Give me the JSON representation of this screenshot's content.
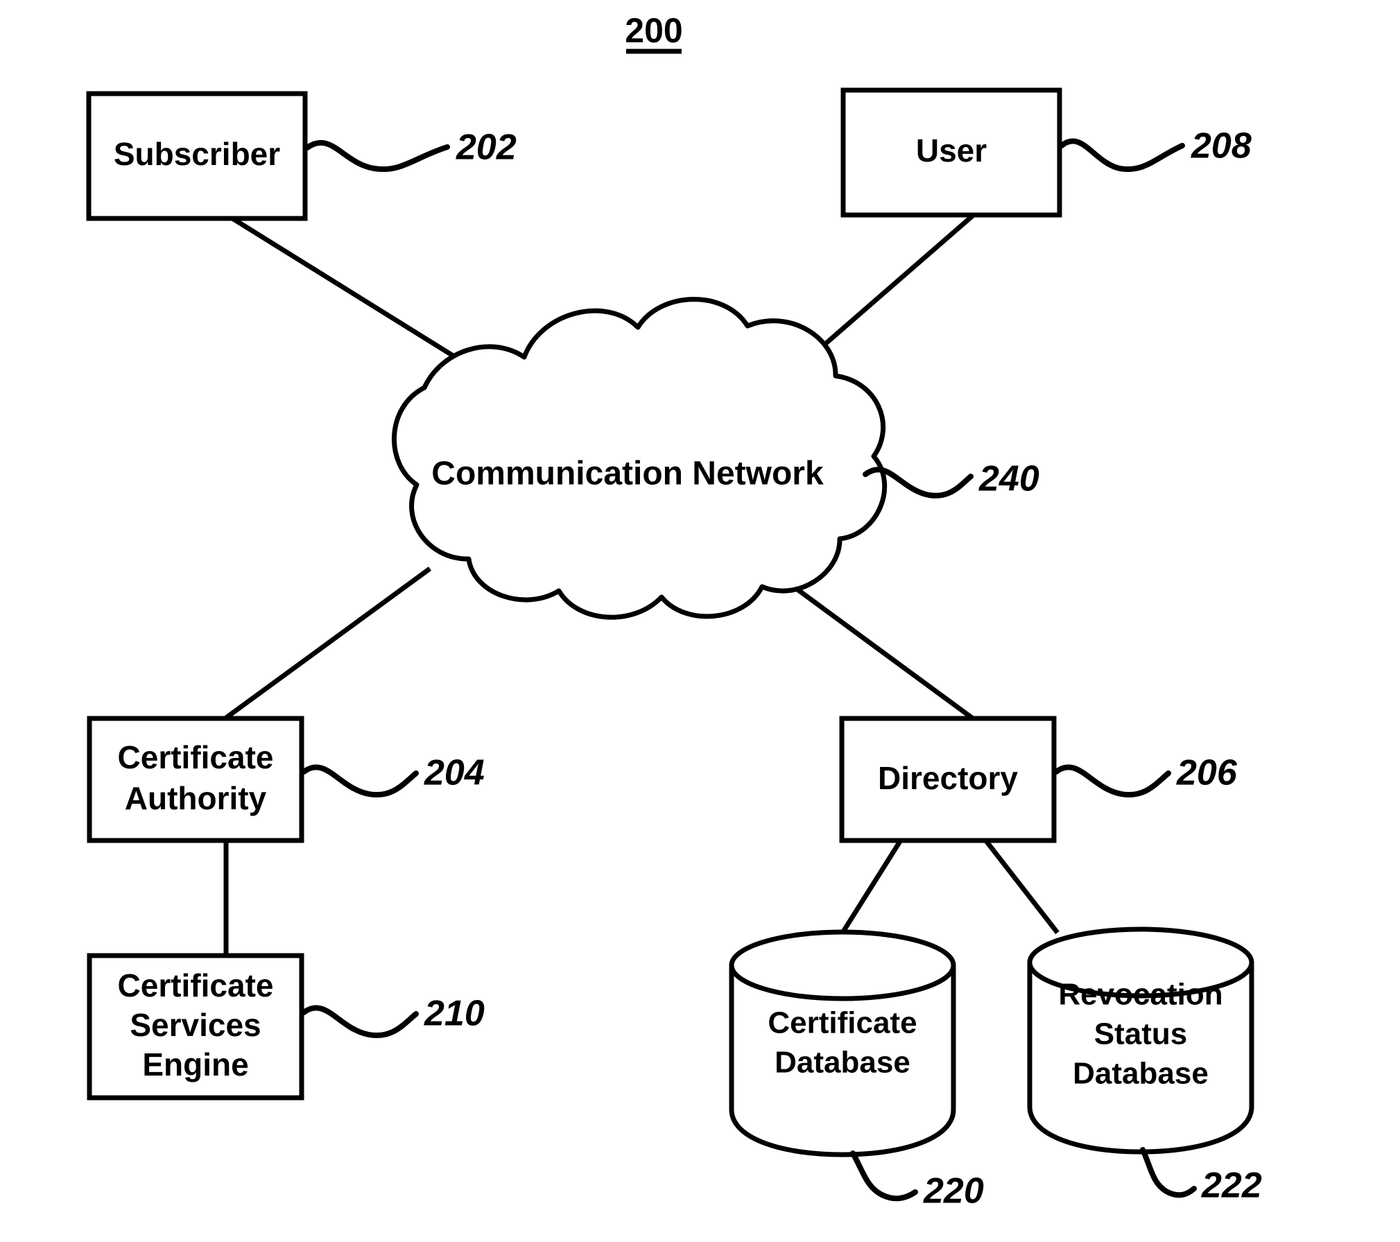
{
  "figure": {
    "number": "200"
  },
  "nodes": {
    "subscriber": {
      "label": "Subscriber",
      "ref": "202"
    },
    "user": {
      "label": "User",
      "ref": "208"
    },
    "network": {
      "label": "Communication Network",
      "ref": "240"
    },
    "certificate_authority": {
      "label_line1": "Certificate",
      "label_line2": "Authority",
      "ref": "204"
    },
    "directory": {
      "label": "Directory",
      "ref": "206"
    },
    "certificate_services_engine": {
      "label_line1": "Certificate",
      "label_line2": "Services",
      "label_line3": "Engine",
      "ref": "210"
    },
    "certificate_database": {
      "label_line1": "Certificate",
      "label_line2": "Database",
      "ref": "220"
    },
    "revocation_status_database": {
      "label_line1": "Revocation",
      "label_line2": "Status",
      "label_line3": "Database",
      "ref": "222"
    }
  },
  "connections": [
    {
      "from": "subscriber",
      "to": "network"
    },
    {
      "from": "user",
      "to": "network"
    },
    {
      "from": "network",
      "to": "certificate_authority"
    },
    {
      "from": "network",
      "to": "directory"
    },
    {
      "from": "certificate_authority",
      "to": "certificate_services_engine"
    },
    {
      "from": "directory",
      "to": "certificate_database"
    },
    {
      "from": "directory",
      "to": "revocation_status_database"
    }
  ],
  "colors": {
    "stroke": "#000000",
    "background": "#ffffff"
  }
}
